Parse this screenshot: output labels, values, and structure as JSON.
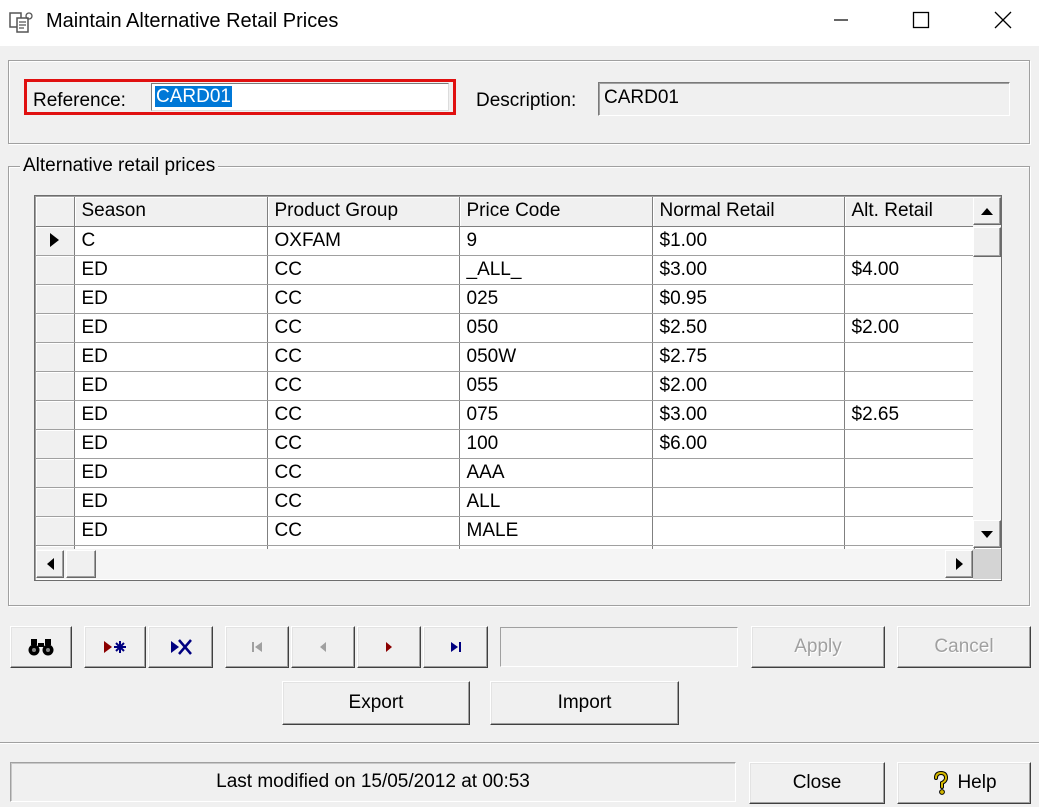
{
  "window": {
    "title": "Maintain Alternative Retail Prices",
    "icon": "app-icon"
  },
  "header": {
    "reference_label": "Reference:",
    "reference_value": "CARD01",
    "description_label": "Description:",
    "description_value": "CARD01"
  },
  "prices": {
    "group_label": "Alternative retail prices",
    "columns": [
      "Season",
      "Product Group",
      "Price Code",
      "Normal Retail",
      "Alt. Retail"
    ],
    "current_row": 0,
    "rows": [
      {
        "season": "C",
        "group": "OXFAM",
        "code": "9",
        "normal": "$1.00",
        "alt": ""
      },
      {
        "season": "ED",
        "group": "CC",
        "code": "_ALL_",
        "normal": "$3.00",
        "alt": "$4.00"
      },
      {
        "season": "ED",
        "group": "CC",
        "code": "025",
        "normal": "$0.95",
        "alt": ""
      },
      {
        "season": "ED",
        "group": "CC",
        "code": "050",
        "normal": "$2.50",
        "alt": "$2.00"
      },
      {
        "season": "ED",
        "group": "CC",
        "code": "050W",
        "normal": "$2.75",
        "alt": ""
      },
      {
        "season": "ED",
        "group": "CC",
        "code": "055",
        "normal": "$2.00",
        "alt": ""
      },
      {
        "season": "ED",
        "group": "CC",
        "code": "075",
        "normal": "$3.00",
        "alt": "$2.65"
      },
      {
        "season": "ED",
        "group": "CC",
        "code": "100",
        "normal": "$6.00",
        "alt": ""
      },
      {
        "season": "ED",
        "group": "CC",
        "code": "AAA",
        "normal": "",
        "alt": ""
      },
      {
        "season": "ED",
        "group": "CC",
        "code": "ALL",
        "normal": "",
        "alt": ""
      },
      {
        "season": "ED",
        "group": "CC",
        "code": "MALE",
        "normal": "",
        "alt": ""
      },
      {
        "season": "",
        "group": "",
        "code": "",
        "normal": "",
        "alt": ""
      }
    ]
  },
  "toolbar": {
    "find_icon": "binoculars-icon",
    "insert_icon": "insert-record-icon",
    "delete_icon": "delete-record-icon",
    "first_icon": "first-record-icon",
    "prev_icon": "previous-record-icon",
    "next_icon": "next-record-icon",
    "last_icon": "last-record-icon",
    "apply_label": "Apply",
    "cancel_label": "Cancel",
    "export_label": "Export",
    "import_label": "Import"
  },
  "footer": {
    "status_text": "Last modified on 15/05/2012 at 00:53",
    "close_label": "Close",
    "help_label": "Help"
  },
  "colors": {
    "selection": "#0078d7",
    "highlight_border": "#e01010",
    "nav_red": "#8b0000",
    "nav_blue": "#000080",
    "help_icon": "#d4b800"
  }
}
